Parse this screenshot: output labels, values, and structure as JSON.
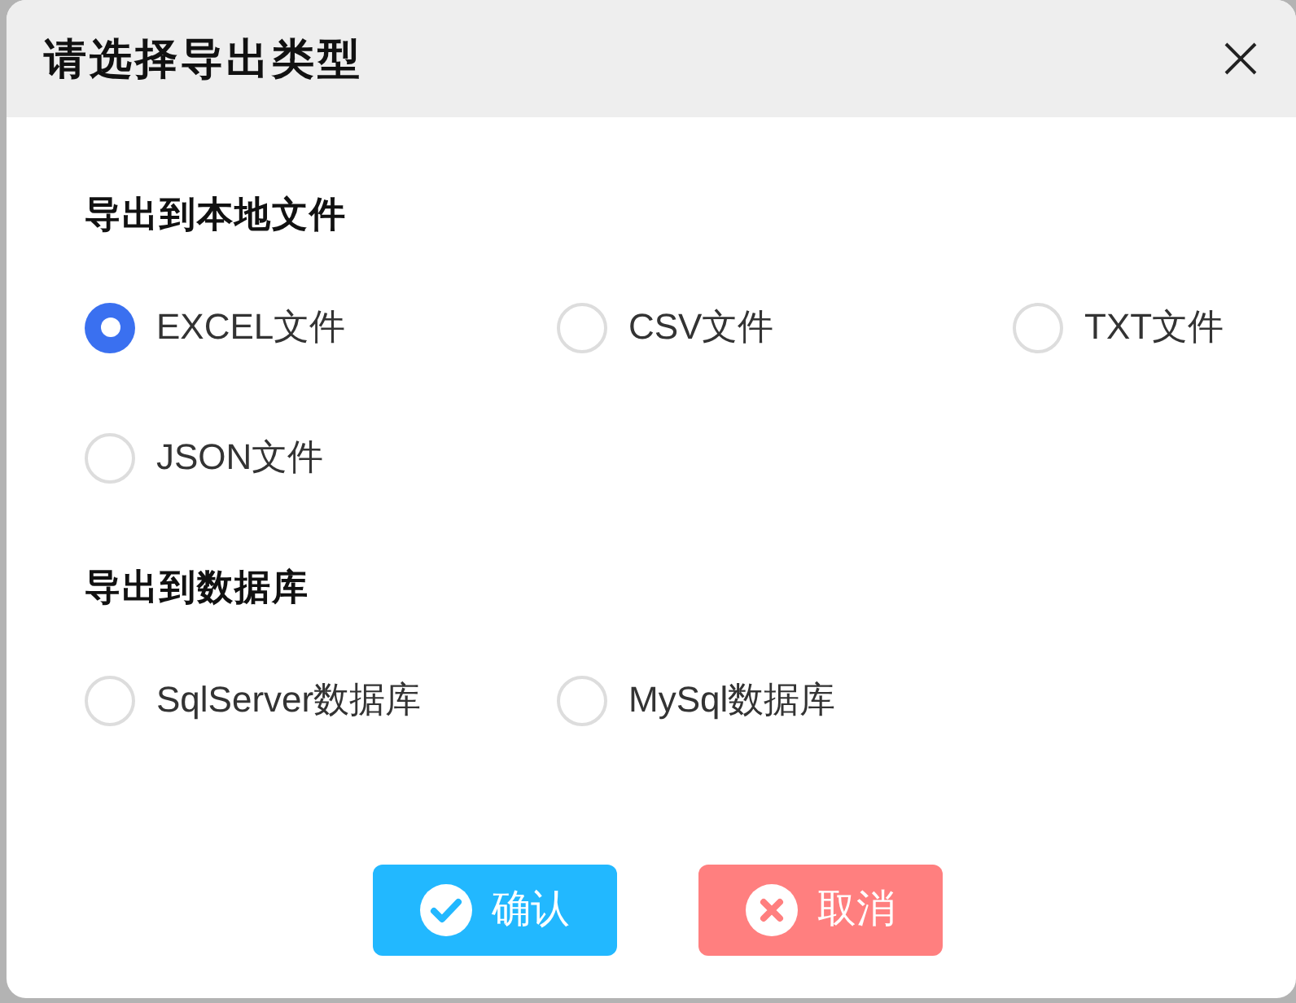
{
  "dialog": {
    "title": "请选择导出类型"
  },
  "sections": [
    {
      "heading": "导出到本地文件",
      "options": [
        {
          "label": "EXCEL文件",
          "selected": true
        },
        {
          "label": "CSV文件",
          "selected": false
        },
        {
          "label": "TXT文件",
          "selected": false
        },
        {
          "label": "JSON文件",
          "selected": false
        }
      ]
    },
    {
      "heading": "导出到数据库",
      "options": [
        {
          "label": "SqlServer数据库",
          "selected": false
        },
        {
          "label": "MySql数据库",
          "selected": false
        }
      ]
    }
  ],
  "buttons": [
    {
      "kind": "confirm",
      "label": "确认"
    },
    {
      "kind": "cancel",
      "label": "取消"
    }
  ]
}
